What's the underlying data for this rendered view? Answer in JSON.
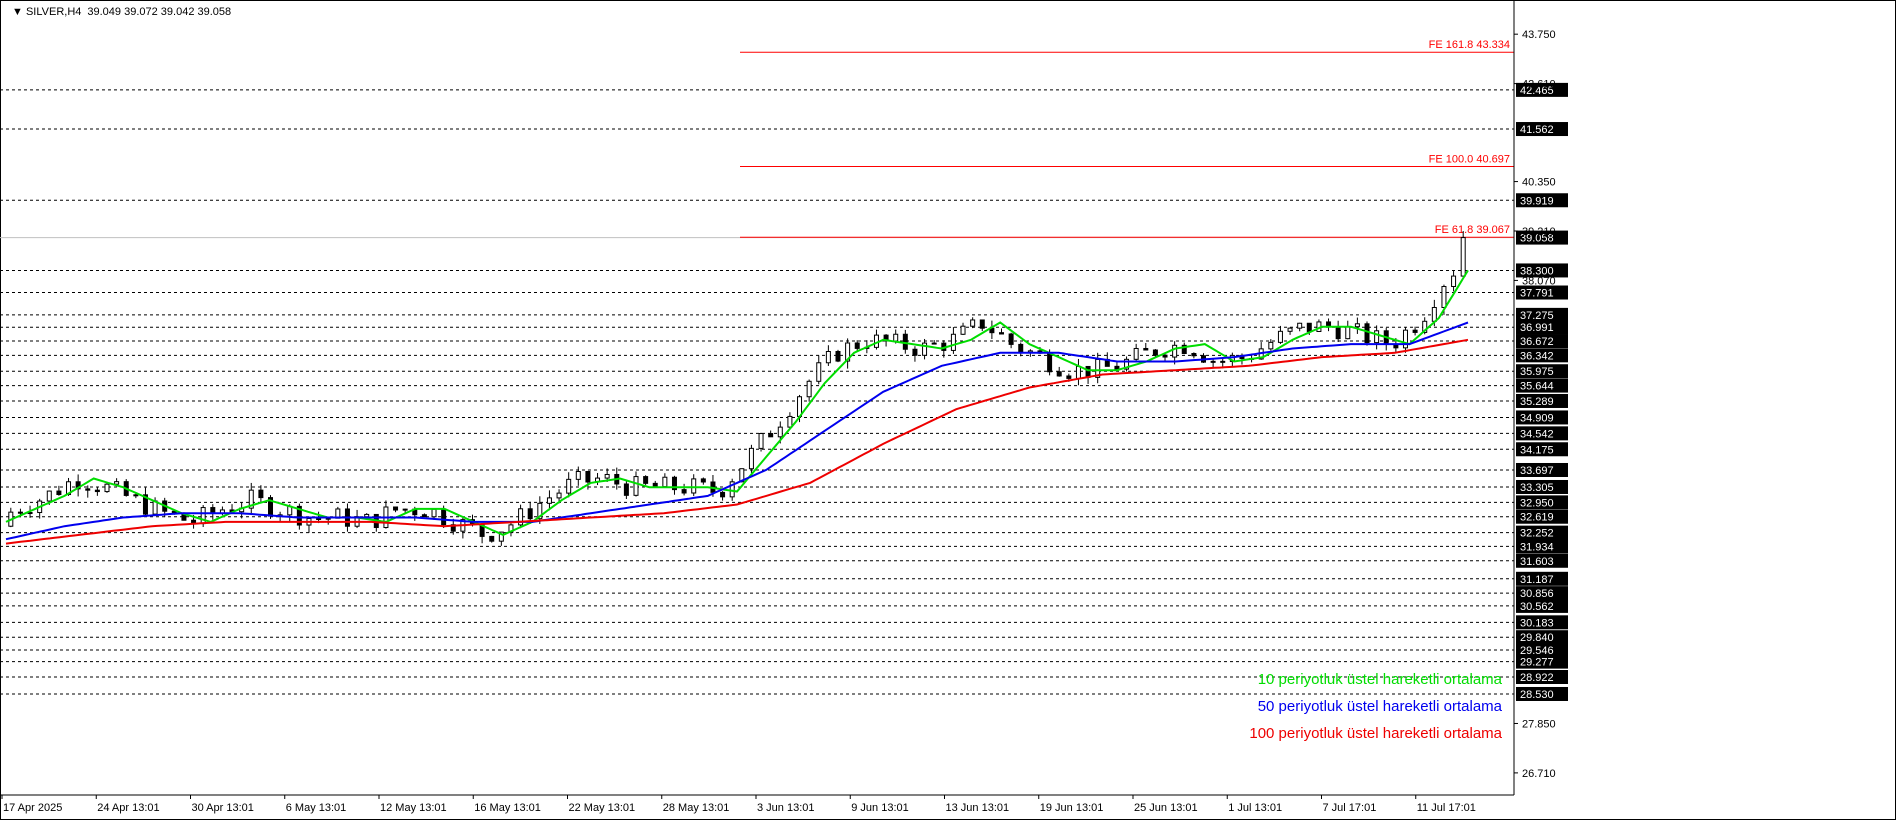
{
  "header": {
    "symbol": "SILVER,H4",
    "ohlc": "39.049 39.072 39.042 39.058"
  },
  "colors": {
    "ema10": "#00dd00",
    "ema50": "#0000ee",
    "ema100": "#ee0000",
    "fe_line": "#ff0000",
    "grid": "#000000",
    "price_line": "#c0c0c0",
    "candle": "#000000",
    "level_box": "#000000",
    "current_box": "#000000"
  },
  "chart_data": {
    "type": "candlestick",
    "symbol": "SILVER",
    "timeframe": "H4",
    "ylim": [
      26.2,
      44.4
    ],
    "current_price": 39.058,
    "x_labels": [
      "17 Apr 2025",
      "24 Apr 13:01",
      "30 Apr 13:01",
      "6 May 13:01",
      "12 May 13:01",
      "16 May 13:01",
      "22 May 13:01",
      "28 May 13:01",
      "3 Jun 13:01",
      "9 Jun 13:01",
      "13 Jun 13:01",
      "19 Jun 13:01",
      "25 Jun 13:01",
      "1 Jul 13:01",
      "7 Jul 17:01",
      "11 Jul 17:01"
    ],
    "price_ticks": [
      "43.750",
      "42.610",
      "40.350",
      "39.210",
      "38.070",
      "26.710",
      "27.850"
    ],
    "levels": [
      "42.465",
      "41.562",
      "39.919",
      "38.300",
      "37.791",
      "37.275",
      "36.991",
      "36.672",
      "36.342",
      "35.975",
      "35.644",
      "35.289",
      "34.909",
      "34.542",
      "34.175",
      "33.697",
      "33.305",
      "32.950",
      "32.619",
      "32.252",
      "31.934",
      "31.603",
      "31.187",
      "30.856",
      "30.562",
      "30.183",
      "29.840",
      "29.546",
      "29.277",
      "28.922",
      "28.530"
    ],
    "fibonacci": [
      {
        "label": "FE 161.8 43.334",
        "price": 43.334
      },
      {
        "label": "FE 100.0 40.697",
        "price": 40.697
      },
      {
        "label": "FE 61.8 39.067",
        "price": 39.067
      }
    ],
    "series": [
      {
        "name": "10 periyotluk üstel hareketli ortalama",
        "color": "#00dd00",
        "x": [
          0,
          0.02,
          0.04,
          0.06,
          0.08,
          0.1,
          0.12,
          0.14,
          0.16,
          0.18,
          0.2,
          0.22,
          0.24,
          0.26,
          0.28,
          0.3,
          0.32,
          0.34,
          0.36,
          0.38,
          0.4,
          0.42,
          0.44,
          0.46,
          0.48,
          0.5,
          0.52,
          0.54,
          0.56,
          0.58,
          0.6,
          0.62,
          0.64,
          0.66,
          0.68,
          0.7,
          0.72,
          0.74,
          0.76,
          0.78,
          0.8,
          0.82,
          0.84,
          0.86,
          0.88,
          0.9,
          0.92,
          0.94,
          0.96,
          0.98,
          1.0
        ],
        "values": [
          32.5,
          32.8,
          33.1,
          33.5,
          33.3,
          33.0,
          32.7,
          32.5,
          32.8,
          33.0,
          32.8,
          32.6,
          32.6,
          32.5,
          32.8,
          32.8,
          32.5,
          32.2,
          32.5,
          33.0,
          33.4,
          33.5,
          33.3,
          33.3,
          33.3,
          33.2,
          34.0,
          34.8,
          35.7,
          36.4,
          36.7,
          36.6,
          36.5,
          36.7,
          37.1,
          36.6,
          36.3,
          36.0,
          36.0,
          36.2,
          36.5,
          36.6,
          36.2,
          36.3,
          36.7,
          37.0,
          37.0,
          36.8,
          36.6,
          37.2,
          38.3
        ]
      },
      {
        "name": "50 periyotluk üstel hareketli ortalama",
        "color": "#0000ee",
        "x": [
          0,
          0.04,
          0.08,
          0.12,
          0.16,
          0.2,
          0.24,
          0.28,
          0.32,
          0.36,
          0.4,
          0.44,
          0.48,
          0.52,
          0.56,
          0.6,
          0.64,
          0.68,
          0.72,
          0.76,
          0.8,
          0.84,
          0.88,
          0.92,
          0.96,
          1.0
        ],
        "values": [
          32.1,
          32.4,
          32.6,
          32.7,
          32.7,
          32.6,
          32.6,
          32.6,
          32.5,
          32.5,
          32.7,
          32.9,
          33.1,
          33.7,
          34.6,
          35.5,
          36.1,
          36.4,
          36.4,
          36.2,
          36.2,
          36.3,
          36.5,
          36.6,
          36.6,
          37.1
        ]
      },
      {
        "name": "100 periyotluk üstel hareketli ortalama",
        "color": "#ee0000",
        "x": [
          0,
          0.05,
          0.1,
          0.15,
          0.2,
          0.25,
          0.3,
          0.35,
          0.4,
          0.45,
          0.5,
          0.55,
          0.6,
          0.65,
          0.7,
          0.75,
          0.8,
          0.85,
          0.9,
          0.95,
          1.0
        ],
        "values": [
          32.0,
          32.2,
          32.4,
          32.5,
          32.5,
          32.5,
          32.4,
          32.5,
          32.6,
          32.7,
          32.9,
          33.4,
          34.3,
          35.1,
          35.6,
          35.9,
          36.0,
          36.1,
          36.3,
          36.4,
          36.7
        ]
      }
    ],
    "candles": {
      "count": 152,
      "open": 32.4,
      "close": 39.058,
      "high": 39.21,
      "low": 31.6
    }
  }
}
